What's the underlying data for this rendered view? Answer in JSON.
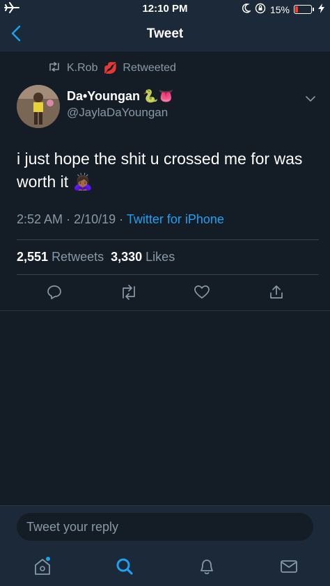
{
  "status_bar": {
    "time": "12:10 PM",
    "battery_percent": "15%",
    "battery_level": 0.15,
    "battery_color": "#ff3b30",
    "icons": [
      "airplane-icon",
      "moon-icon",
      "orientation-lock-icon",
      "battery-icon",
      "charging-bolt-icon"
    ]
  },
  "nav": {
    "title": "Tweet",
    "back_icon": "chevron-left-icon"
  },
  "tweet": {
    "retweeted_by": "K.Rob",
    "retweeted_by_emoji": "💋",
    "retweeted_label": "Retweeted",
    "display_name": "Da•Youngan",
    "display_name_emoji": "🐍👅",
    "handle": "@JaylaDaYoungan",
    "text": "i just hope the shit u crossed me for was worth it 🙇🏾‍♀️",
    "time": "2:52 AM",
    "date": "2/10/19",
    "separator": "·",
    "source": "Twitter for iPhone",
    "retweets_count": "2,551",
    "retweets_label": "Retweets",
    "likes_count": "3,330",
    "likes_label": "Likes"
  },
  "reply": {
    "placeholder": "Tweet your reply"
  },
  "tabs": [
    {
      "name": "home",
      "icon": "home-icon"
    },
    {
      "name": "search",
      "icon": "search-icon"
    },
    {
      "name": "notifications",
      "icon": "bell-icon"
    },
    {
      "name": "messages",
      "icon": "mail-icon"
    }
  ],
  "colors": {
    "background": "#141d26",
    "bar_background": "#1c2938",
    "accent": "#1da1f2",
    "secondary_text": "#8899a6"
  }
}
